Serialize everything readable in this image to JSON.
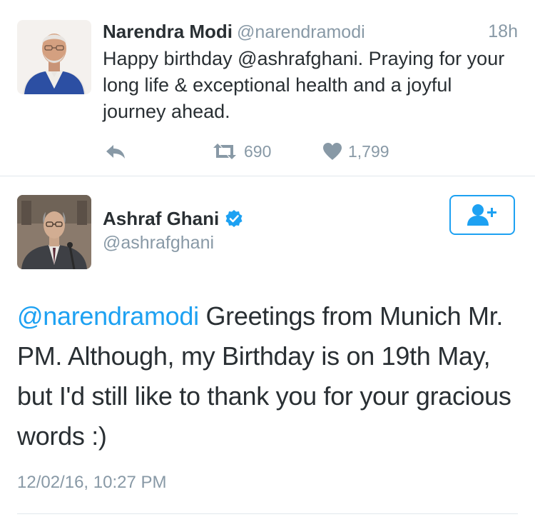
{
  "colors": {
    "link_blue": "#1da1f2",
    "secondary_gray": "#8899a6",
    "text_dark": "#292f33",
    "divider": "#e1e8ed"
  },
  "tweet1": {
    "name": "Narendra Modi",
    "handle": "@narendramodi",
    "time": "18h",
    "text": "Happy birthday @ashrafghani. Praying for your long life & exceptional health and a joyful journey ahead.",
    "actions": {
      "reply_icon": "reply-icon",
      "retweet_icon": "retweet-icon",
      "retweet_count": "690",
      "like_icon": "heart-icon",
      "like_count": "1,799"
    }
  },
  "tweet2": {
    "name": "Ashraf Ghani",
    "verified_icon": "verified-badge-icon",
    "handle": "@ashrafghani",
    "follow_icon": "follow-user-icon",
    "mention": "@narendramodi",
    "text_rest": " Greetings from Munich Mr. PM. Although, my Birthday is on 19th May, but I'd still like to thank you for your gracious words :)",
    "timestamp": "12/02/16, 10:27 PM"
  }
}
